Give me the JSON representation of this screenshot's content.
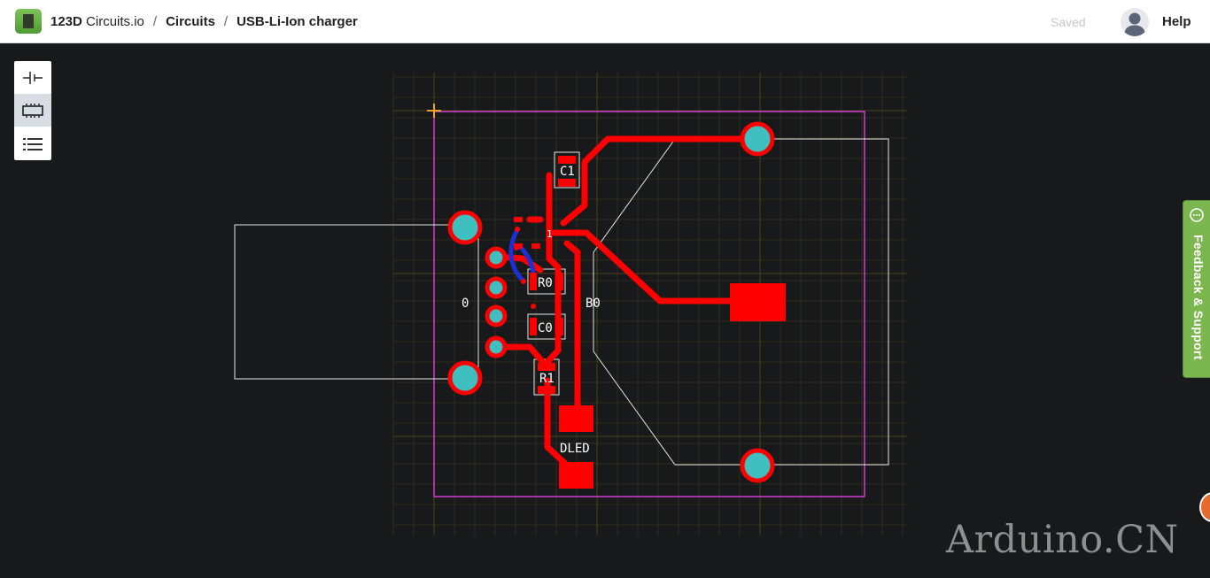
{
  "header": {
    "app_prefix": "123D",
    "app_name": "Circuits.io",
    "separator": "/",
    "breadcrumb_section": "Circuits",
    "breadcrumb_project": "USB-Li-Ion charger",
    "save_status": "Saved",
    "help_label": "Help"
  },
  "toolbar": {
    "items": [
      {
        "icon": "breadboard-icon"
      },
      {
        "icon": "chip-icon",
        "active": true
      },
      {
        "icon": "list-icon"
      }
    ]
  },
  "pcb": {
    "component_labels": {
      "c1": "C1",
      "r0": "R0",
      "c0": "C0",
      "r1": "R1",
      "dled": "DLED",
      "usb": "0",
      "battery": "B0",
      "pin1": "1"
    },
    "colors": {
      "background": "#18191b",
      "board_outline": "#d23bd2",
      "copper": "#ff0000",
      "pad": "#3fbfbf",
      "silkscreen": "#e6e6e6",
      "grid": "#3a3419"
    }
  },
  "feedback": {
    "label": "Feedback & Support"
  },
  "watermark": {
    "text": "Arduino.CN"
  }
}
